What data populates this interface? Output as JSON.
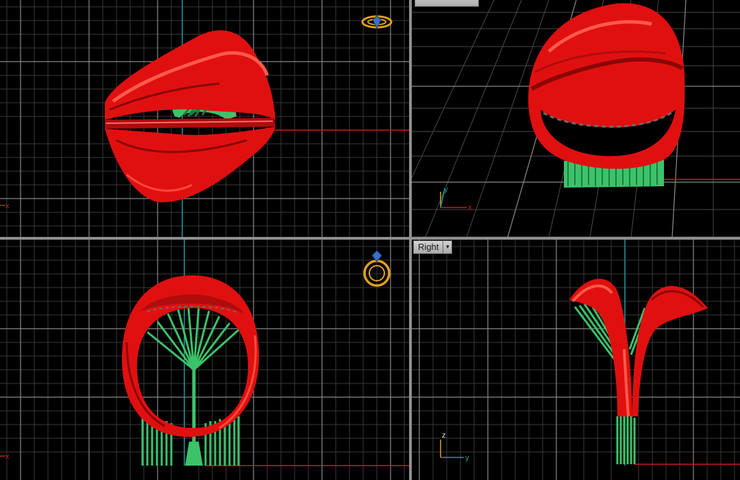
{
  "viewports": {
    "top": {
      "axes": {
        "x_label": "x"
      }
    },
    "perspective": {
      "axes": {
        "x_label": "x",
        "y_label": "y"
      }
    },
    "front": {
      "axes": {
        "x_label": "x"
      }
    },
    "right": {
      "name": "Right",
      "axes": {
        "y_label": "y",
        "z_label": "z"
      }
    }
  },
  "icons": {
    "top_widget": "ring-top-view-icon",
    "front_widget": "ring-front-view-icon",
    "dropdown": "chevron-down-icon"
  },
  "colors": {
    "background": "#000000",
    "grid_minor": "#3a3a3a",
    "grid_major": "#8a8a8a",
    "x_axis": "#c81e1e",
    "y_axis": "#1e9aa0",
    "ring": "#e01010",
    "supports": "#3cc36a",
    "widget": "#e0a020"
  }
}
